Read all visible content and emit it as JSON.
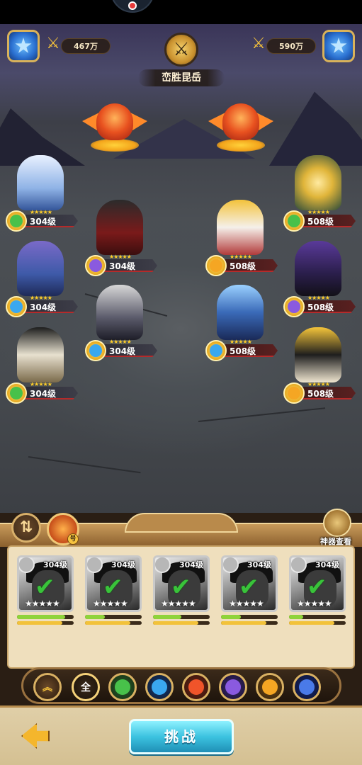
{
  "status_bar": {},
  "hud": {
    "player_power": "467万",
    "enemy_power": "590万",
    "arena_title": "峦胜昆岳"
  },
  "colors": {
    "ally_ribbon": "#2b2b35",
    "enemy_ribbon": "#5a2020",
    "accent_gold": "#f5c23a",
    "challenge_blue": "#3cc3e0"
  },
  "ally_heroes": [
    {
      "level": "304级",
      "stars": "★★★★★",
      "element": "nature"
    },
    {
      "level": "304级",
      "stars": "★★★★★",
      "element": "moon"
    },
    {
      "level": "304级",
      "stars": "★★★★★",
      "element": "water"
    },
    {
      "level": "304级",
      "stars": "★★★★★",
      "element": "water"
    },
    {
      "level": "304级",
      "stars": "★★★★★",
      "element": "nature"
    }
  ],
  "enemy_heroes": [
    {
      "level": "508级",
      "stars": "★★★★★",
      "element": "nature"
    },
    {
      "level": "508级",
      "stars": "★★★★★",
      "element": "sun"
    },
    {
      "level": "508级",
      "stars": "★★★★★",
      "element": "moon"
    },
    {
      "level": "508级",
      "stars": "★★★★★",
      "element": "water"
    },
    {
      "level": "508级",
      "stars": "★★★★★",
      "element": "sun"
    }
  ],
  "panel": {
    "artifact_label": "神器查看",
    "pet_badge": "号"
  },
  "roster": [
    {
      "level": "304级",
      "stars": "★★★★★",
      "hp": 0.85,
      "energy": 0.8
    },
    {
      "level": "304级",
      "stars": "★★★★★",
      "hp": 0.35,
      "energy": 0.8
    },
    {
      "level": "304级",
      "stars": "★★★★★",
      "hp": 0.5,
      "energy": 0.8
    },
    {
      "level": "304级",
      "stars": "★★★★★",
      "hp": 0.35,
      "energy": 0.8
    },
    {
      "level": "304级",
      "stars": "★★★★★",
      "hp": 0.25,
      "energy": 0.8
    }
  ],
  "filters": [
    {
      "name": "filter-up",
      "label": "",
      "icon": "double-chevron-up-icon"
    },
    {
      "name": "filter-all",
      "label": "全",
      "icon": ""
    },
    {
      "name": "filter-nature",
      "label": "",
      "icon": "leaf-icon"
    },
    {
      "name": "filter-water",
      "label": "",
      "icon": "wave-icon"
    },
    {
      "name": "filter-fire",
      "label": "",
      "icon": "flame-icon"
    },
    {
      "name": "filter-moon",
      "label": "",
      "icon": "moon-icon"
    },
    {
      "name": "filter-sun",
      "label": "",
      "icon": "sun-icon"
    },
    {
      "name": "filter-void",
      "label": "",
      "icon": "swirl-icon"
    }
  ],
  "footer": {
    "challenge_label": "挑战"
  }
}
